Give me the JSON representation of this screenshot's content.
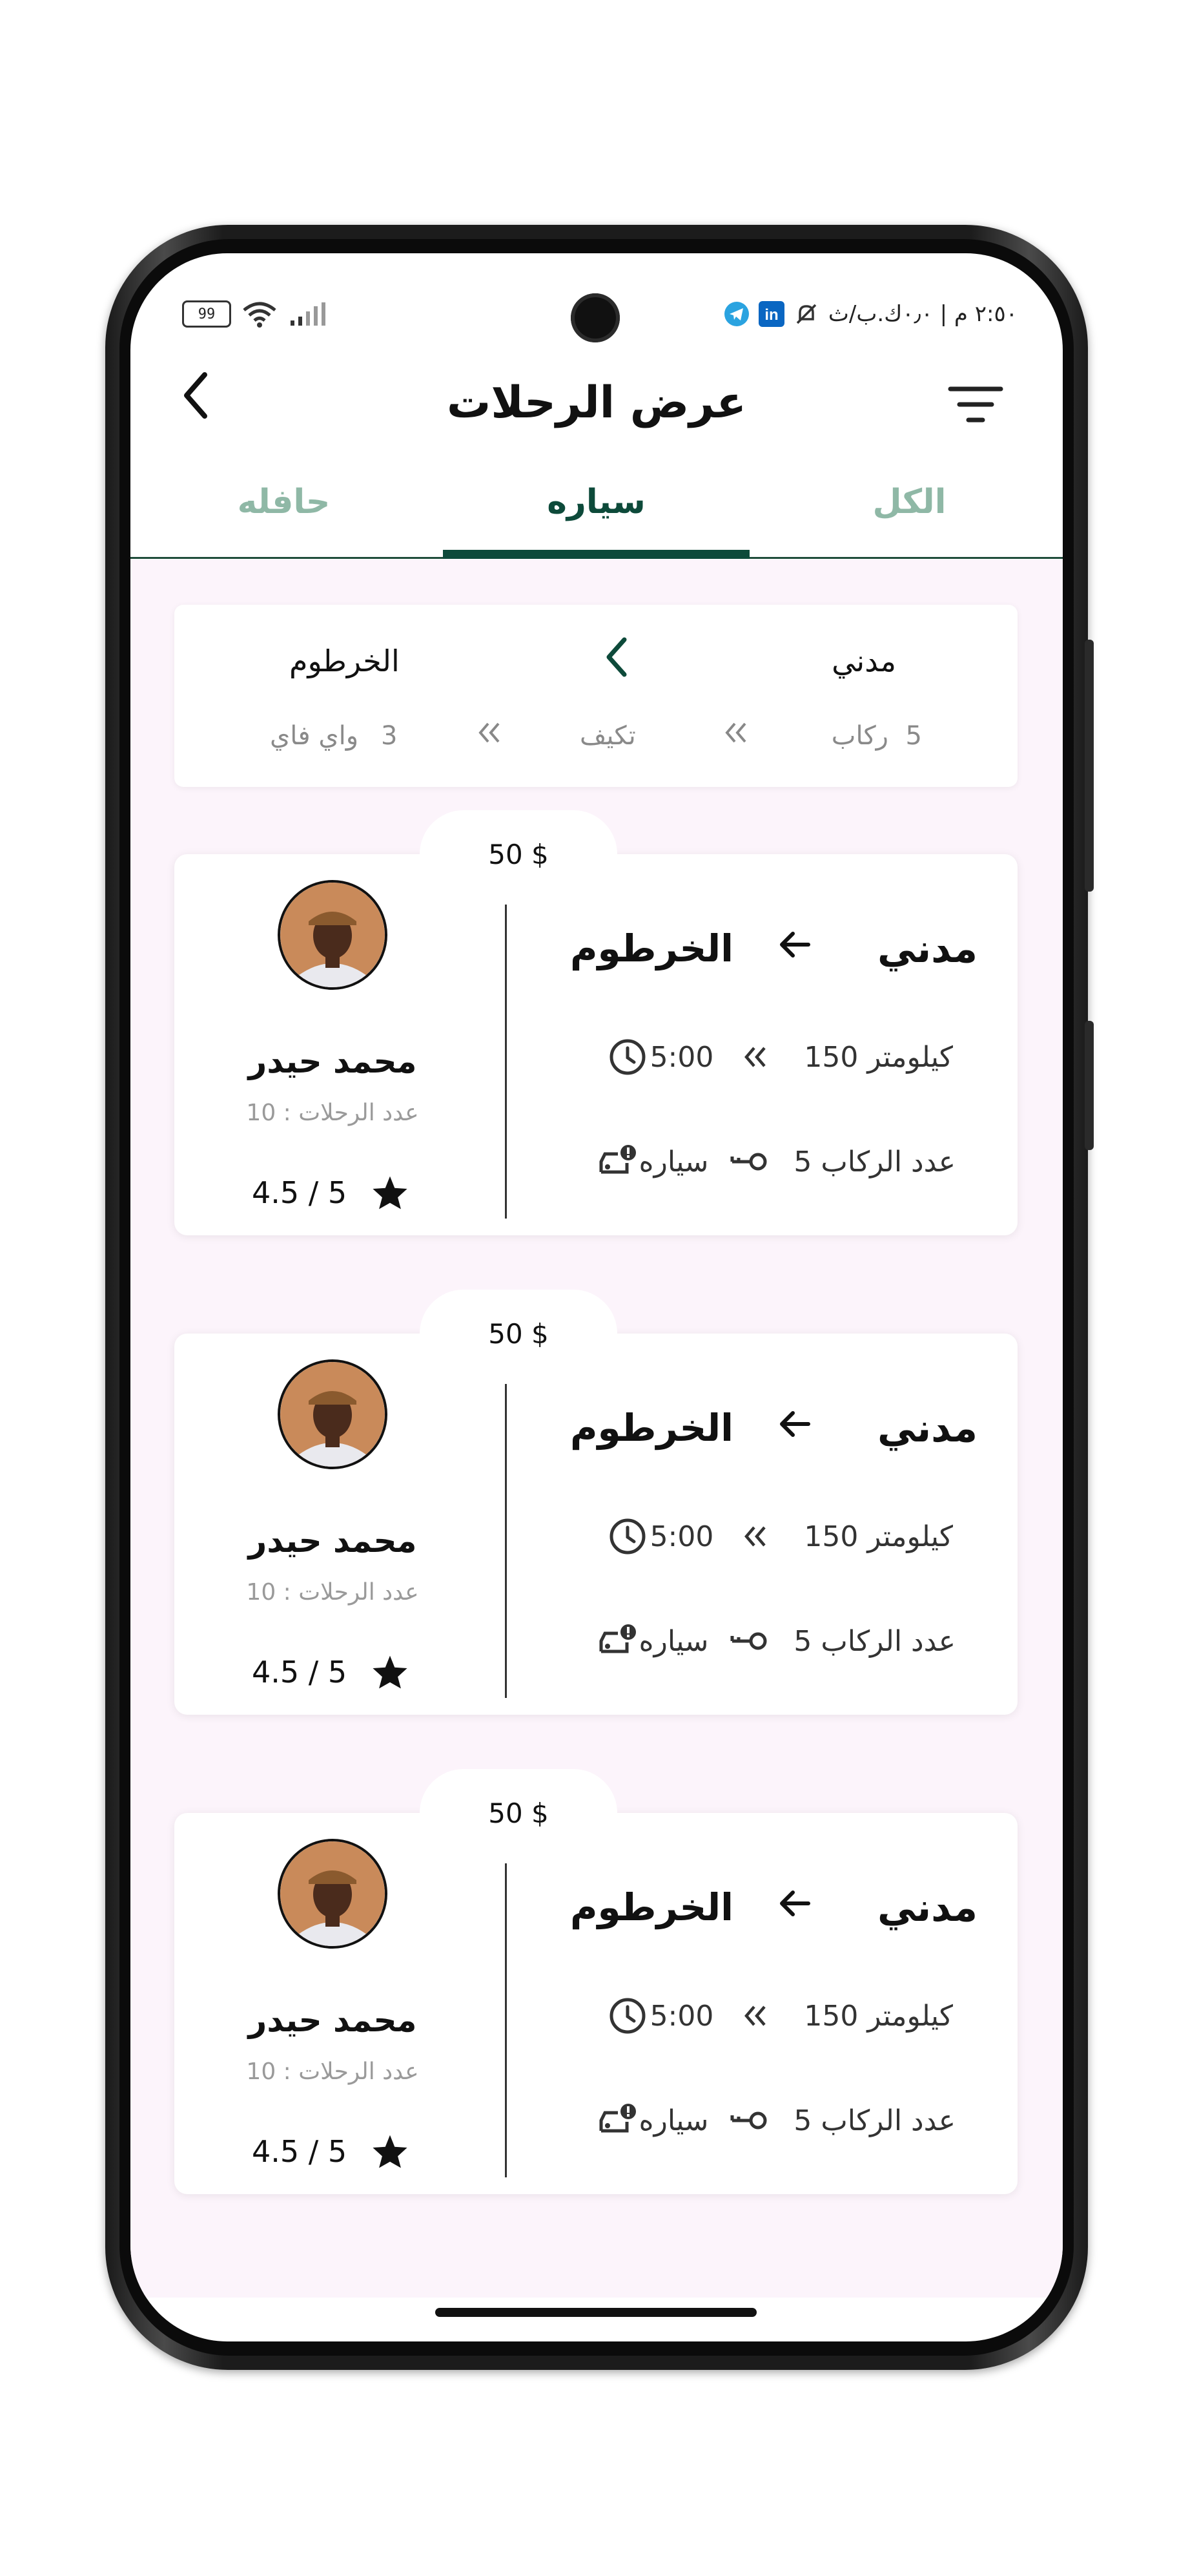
{
  "status_bar": {
    "time_text": "٢:٥٠ م | ٠٫٠ك.ب/ث",
    "battery": "99",
    "icons": [
      "telegram-icon",
      "linkedin-icon",
      "mute-bell-icon",
      "wifi-icon",
      "signal-icon"
    ]
  },
  "header": {
    "title": "عرض الرحلات",
    "back_icon": "chevron-left-icon",
    "filter_icon": "filter-lines-icon"
  },
  "tabs": [
    {
      "label": "الكل",
      "selected": false
    },
    {
      "label": "سياره",
      "selected": true
    },
    {
      "label": "حافله",
      "selected": false
    }
  ],
  "summary": {
    "from": "مدني",
    "to": "الخرطوم",
    "passengers_count": "5",
    "passengers_label": "ركاب",
    "ac": "تكيف",
    "wifi_count": "3",
    "wifi_label": "واي فاي"
  },
  "trips": [
    {
      "price": "50 $",
      "from": "مدني",
      "to": "الخرطوم",
      "time": "5:00",
      "distance": "150 كيلومتر",
      "vehicle": "سياره",
      "passengers": "عدد الركاب 5",
      "driver_name": "محمد حيدر",
      "driver_trips": "عدد الرحلات : 10",
      "rating": "4.5 / 5"
    },
    {
      "price": "50 $",
      "from": "مدني",
      "to": "الخرطوم",
      "time": "5:00",
      "distance": "150 كيلومتر",
      "vehicle": "سياره",
      "passengers": "عدد الركاب 5",
      "driver_name": "محمد حيدر",
      "driver_trips": "عدد الرحلات : 10",
      "rating": "4.5 / 5"
    },
    {
      "price": "50 $",
      "from": "مدني",
      "to": "الخرطوم",
      "time": "5:00",
      "distance": "150 كيلومتر",
      "vehicle": "سياره",
      "passengers": "عدد الركاب 5",
      "driver_name": "محمد حيدر",
      "driver_trips": "عدد الرحلات : 10",
      "rating": "4.5 / 5"
    }
  ],
  "colors": {
    "accent": "#0d4a3a",
    "tab_inactive": "#8fb8a6",
    "content_bg": "#fcf4fb",
    "muted_text": "#9a9a9a"
  }
}
